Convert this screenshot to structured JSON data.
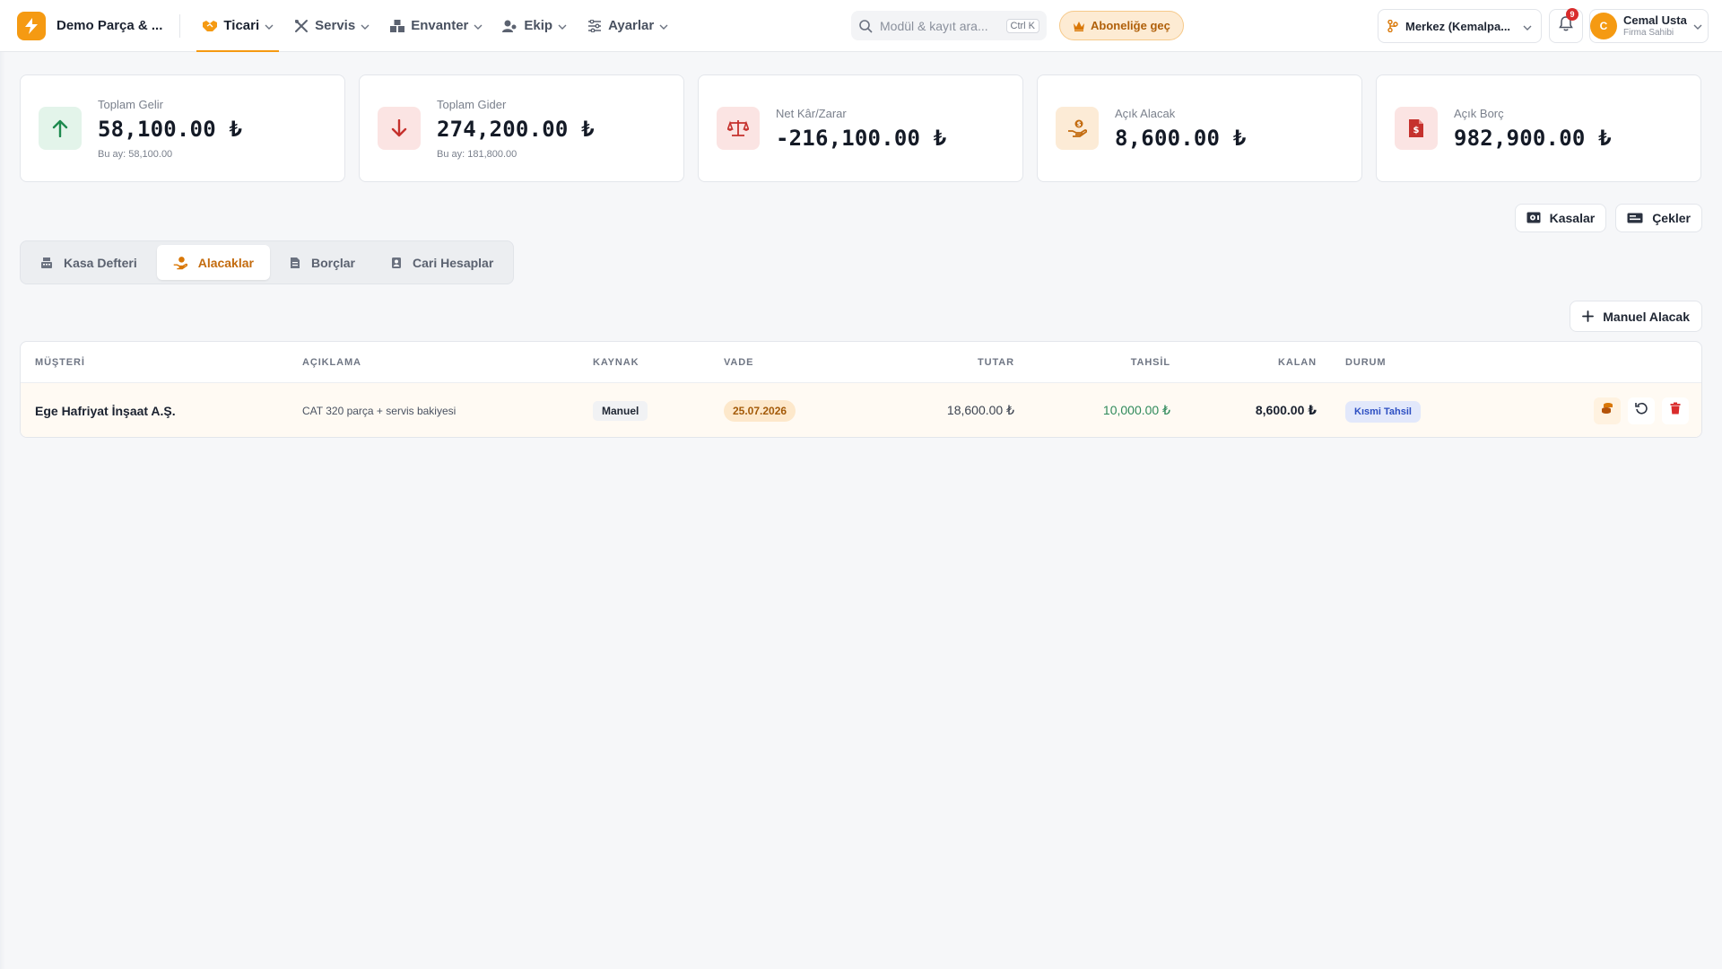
{
  "app": {
    "company_name": "Demo Parça & ...",
    "accent_color": "#f59a12"
  },
  "nav": {
    "items": [
      {
        "label": "Ticari",
        "icon": "handshake-icon",
        "active": true
      },
      {
        "label": "Servis",
        "icon": "tools-icon",
        "active": false
      },
      {
        "label": "Envanter",
        "icon": "boxes-icon",
        "active": false
      },
      {
        "label": "Ekip",
        "icon": "users-icon",
        "active": false
      },
      {
        "label": "Ayarlar",
        "icon": "sliders-icon",
        "active": false
      }
    ]
  },
  "search": {
    "placeholder": "Modül & kayıt ara...",
    "shortcut": "Ctrl K"
  },
  "upgrade": {
    "label": "Aboneliğe geç"
  },
  "branch": {
    "label": "Merkez (Kemalpa..."
  },
  "notifications": {
    "count": "9"
  },
  "user": {
    "initial": "C",
    "name": "Cemal Usta",
    "role": "Firma Sahibi"
  },
  "stats": [
    {
      "label": "Toplam Gelir",
      "value": "58,100.00 ₺",
      "sub": "Bu ay: 58,100.00",
      "icon": "arrow-up-icon",
      "color": "#1e8a4f",
      "bg": "#e3f4ea"
    },
    {
      "label": "Toplam Gider",
      "value": "274,200.00 ₺",
      "sub": "Bu ay: 181,800.00",
      "icon": "arrow-down-icon",
      "color": "#c5312d",
      "bg": "#fbe4e3"
    },
    {
      "label": "Net Kâr/Zarar",
      "value": "-216,100.00 ₺",
      "sub": "",
      "icon": "scale-icon",
      "color": "#c5312d",
      "bg": "#fbe4e3"
    },
    {
      "label": "Açık Alacak",
      "value": "8,600.00 ₺",
      "sub": "",
      "icon": "hand-coin-icon",
      "color": "#c36b0e",
      "bg": "#fcebd6"
    },
    {
      "label": "Açık Borç",
      "value": "982,900.00 ₺",
      "sub": "",
      "icon": "invoice-dollar-icon",
      "color": "#c5312d",
      "bg": "#fbe4e3"
    }
  ],
  "quick_buttons": {
    "kasalar": "Kasalar",
    "cekler": "Çekler"
  },
  "tabs": [
    {
      "label": "Kasa Defteri",
      "icon": "cash-register-icon",
      "active": false
    },
    {
      "label": "Alacaklar",
      "icon": "hand-coin-icon",
      "active": true
    },
    {
      "label": "Borçlar",
      "icon": "invoice-icon",
      "active": false
    },
    {
      "label": "Cari Hesaplar",
      "icon": "contact-book-icon",
      "active": false
    }
  ],
  "add_button": {
    "label": "Manuel Alacak"
  },
  "table": {
    "headers": {
      "musteri": "MÜŞTERİ",
      "aciklama": "AÇIKLAMA",
      "kaynak": "KAYNAK",
      "vade": "VADE",
      "tutar": "TUTAR",
      "tahsil": "TAHSİL",
      "kalan": "KALAN",
      "durum": "DURUM"
    },
    "rows": [
      {
        "musteri": "Ege Hafriyat İnşaat A.Ş.",
        "aciklama": "CAT 320 parça + servis bakiyesi",
        "kaynak": "Manuel",
        "vade": "25.07.2026",
        "tutar": "18,600.00 ₺",
        "tahsil": "10,000.00 ₺",
        "kalan": "8,600.00 ₺",
        "durum": "Kısmi Tahsil"
      }
    ]
  }
}
